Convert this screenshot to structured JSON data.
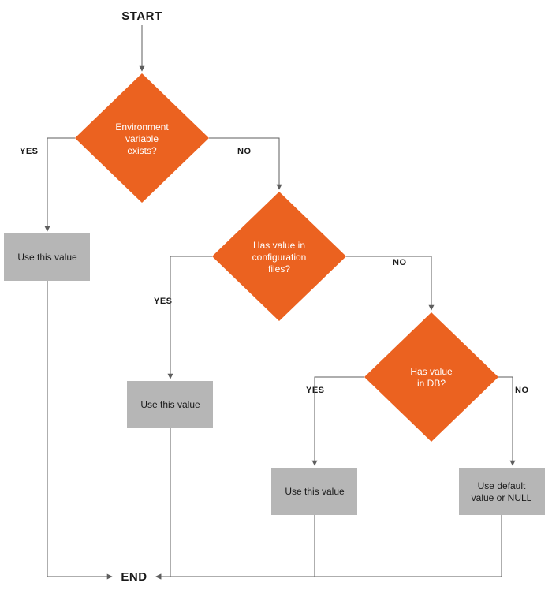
{
  "colors": {
    "decision_fill": "#eb6220",
    "process_fill": "#b6b6b6",
    "connector": "#5e5e5e",
    "text_dark": "#1a1a1a",
    "text_light": "#ffffff"
  },
  "labels": {
    "start": "START",
    "end": "END",
    "yes": "YES",
    "no": "NO"
  },
  "decisions": {
    "env": {
      "line1": "Environment",
      "line2": "variable",
      "line3": "exists?"
    },
    "config": {
      "line1": "Has value in",
      "line2": "configuration",
      "line3": "files?"
    },
    "db": {
      "line1": "Has value",
      "line2": "in DB?"
    }
  },
  "processes": {
    "use1": "Use this value",
    "use2": "Use this value",
    "use3": "Use this value",
    "default": {
      "line1": "Use default",
      "line2": "value or NULL"
    }
  }
}
